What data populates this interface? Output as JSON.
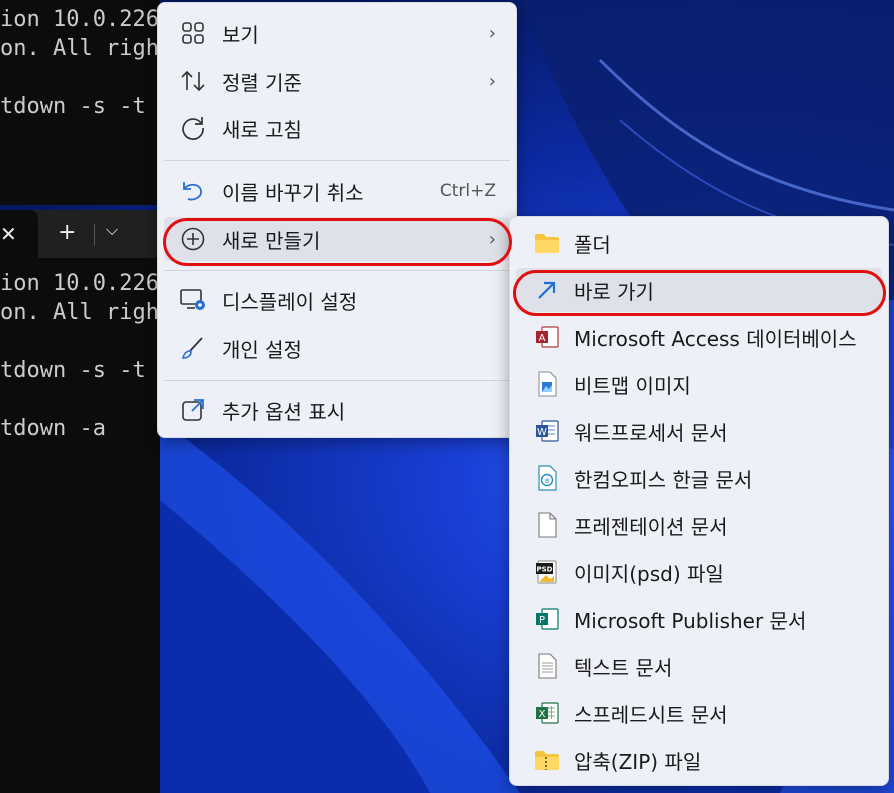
{
  "terminal_top": {
    "lines": [
      "ion 10.0.226",
      "on. All righ",
      "",
      "tdown -s -t"
    ]
  },
  "terminal_bottom": {
    "tab_close": "✕",
    "new_tab": "+",
    "dropdown": "⌵",
    "lines": [
      "ion 10.0.226",
      "on. All righ",
      "",
      "tdown -s -t",
      "",
      "tdown -a"
    ]
  },
  "main_menu": {
    "items": [
      {
        "label": "보기",
        "icon": "grid-view-icon",
        "arrow": "›"
      },
      {
        "label": "정렬 기준",
        "icon": "sort-icon",
        "arrow": "›"
      },
      {
        "label": "새로 고침",
        "icon": "refresh-icon"
      },
      {
        "label": "이름 바꾸기 취소",
        "icon": "undo-icon",
        "shortcut": "Ctrl+Z"
      },
      {
        "label": "새로 만들기",
        "icon": "new-plus-icon",
        "arrow": "›"
      },
      {
        "label": "디스플레이 설정",
        "icon": "display-settings-icon"
      },
      {
        "label": "개인 설정",
        "icon": "brush-icon"
      },
      {
        "label": "추가 옵션 표시",
        "icon": "more-options-icon"
      }
    ]
  },
  "sub_menu": {
    "items": [
      {
        "label": "폴더",
        "icon": "folder-icon"
      },
      {
        "label": "바로 가기",
        "icon": "shortcut-arrow-icon"
      },
      {
        "label": "Microsoft Access 데이터베이스",
        "icon": "access-icon"
      },
      {
        "label": "비트맵 이미지",
        "icon": "bitmap-icon"
      },
      {
        "label": "워드프로세서 문서",
        "icon": "word-icon"
      },
      {
        "label": "한컴오피스 한글 문서",
        "icon": "hwp-icon"
      },
      {
        "label": "프레젠테이션 문서",
        "icon": "blank-document-icon"
      },
      {
        "label": "이미지(psd) 파일",
        "icon": "psd-icon"
      },
      {
        "label": "Microsoft Publisher 문서",
        "icon": "publisher-icon"
      },
      {
        "label": "텍스트 문서",
        "icon": "text-document-icon"
      },
      {
        "label": "스프레드시트 문서",
        "icon": "excel-icon"
      },
      {
        "label": "압축(ZIP) 파일",
        "icon": "zip-folder-icon"
      }
    ]
  },
  "colors": {
    "annotation": "#e01010",
    "menu_bg": "#eef0f7",
    "hover_bg": "#dfe1ea"
  }
}
